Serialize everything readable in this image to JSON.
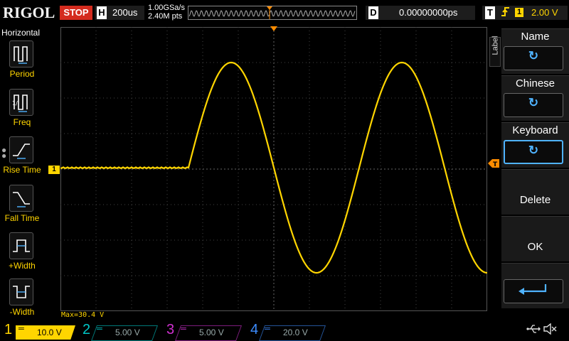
{
  "header": {
    "brand": "RIGOL",
    "run_state": "STOP",
    "horizontal_letter": "H",
    "timebase": "200us",
    "sample_rate": "1.00GSa/s",
    "memory_depth": "2.40M pts",
    "delay_letter": "D",
    "delay": "0.00000000ps",
    "trigger_letter": "T",
    "trigger_edge_icon": "rising-edge-icon",
    "trigger_source": "1",
    "trigger_level": "2.00 V"
  },
  "left_menu": {
    "title": "Horizontal",
    "items": [
      {
        "label": "Period",
        "icon": "period-icon"
      },
      {
        "label": "Freq",
        "icon": "frequency-icon"
      },
      {
        "label": "Rise Time",
        "icon": "rise-time-icon"
      },
      {
        "label": "Fall Time",
        "icon": "fall-time-icon"
      },
      {
        "label": "+Width",
        "icon": "positive-width-icon"
      },
      {
        "label": "-Width",
        "icon": "negative-width-icon"
      }
    ]
  },
  "right_menu": {
    "tab_label": "Label",
    "items": [
      {
        "label": "Name",
        "button_icon": "rotate-knob-icon"
      },
      {
        "label": "Chinese",
        "button_icon": "rotate-knob-icon"
      },
      {
        "label": "Keyboard",
        "button_icon": "rotate-knob-icon",
        "active": true
      },
      {
        "label": "Delete"
      },
      {
        "label": "OK"
      },
      {
        "label": "",
        "button_icon": "enter-icon"
      }
    ]
  },
  "screen": {
    "channel_marker": "1",
    "measurement": "Max=30.4 V"
  },
  "channels": [
    {
      "num": "1",
      "scale": "10.0 V",
      "color": "#ffd500",
      "active": true
    },
    {
      "num": "2",
      "scale": "5.00 V",
      "color": "#00c8c8",
      "active": false
    },
    {
      "num": "3",
      "scale": "5.00 V",
      "color": "#d030d0",
      "active": false
    },
    {
      "num": "4",
      "scale": "20.0 V",
      "color": "#3c8cff",
      "active": false
    }
  ],
  "status_icons": [
    "usb-icon",
    "sound-muted-icon"
  ],
  "colors": {
    "ch1": "#ffd500",
    "stop": "#d42b1e",
    "accent": "#4fb3ff"
  }
}
